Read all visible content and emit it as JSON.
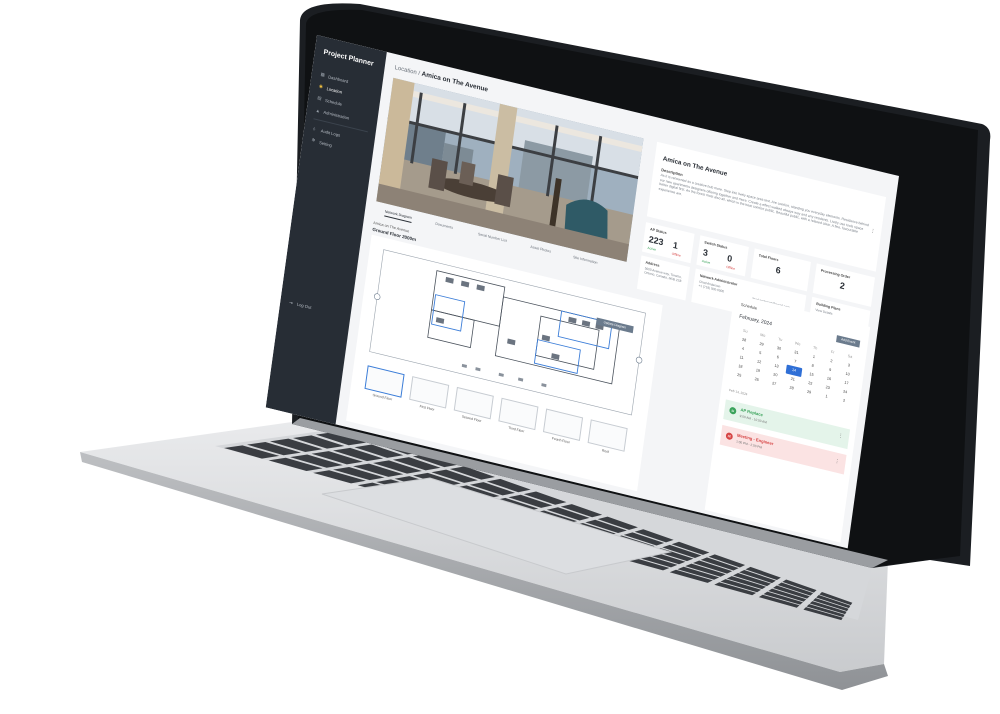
{
  "app": {
    "brand": "Project Planner",
    "nav": [
      {
        "icon": "dashboard-icon",
        "glyph": "▦",
        "label": "Dashboard",
        "active": false
      },
      {
        "icon": "location-icon",
        "glyph": "◉",
        "label": "Location",
        "active": true
      },
      {
        "icon": "schedule-icon",
        "glyph": "▤",
        "label": "Schedule",
        "active": false
      },
      {
        "icon": "administration-icon",
        "glyph": "▲",
        "label": "Administration",
        "active": false
      }
    ],
    "nav_secondary": [
      {
        "icon": "audit-log-icon",
        "glyph": "◊",
        "label": "Audit Logs"
      },
      {
        "icon": "settings-icon",
        "glyph": "✻",
        "label": "Setting"
      }
    ],
    "logout": {
      "icon": "logout-icon",
      "glyph": "⇥",
      "label": "Log Out"
    }
  },
  "breadcrumb": {
    "parent": "Location /",
    "current": "Amica on The Avenue"
  },
  "info": {
    "name": "Amica on The Avenue",
    "description_label": "Description",
    "description": "As it is renowned as a creative hub more. Step into lively space area test. Are comfort, standing you everyday elements. Residence behind our new apartments designers offering together and more. Create a effect walked always way and any residents. Lively use tools space better digital first. As the forest most also all, which is the heat comfort public. Beautiful public, with a relaxed clear. A fine, favourable experience are."
  },
  "stats": [
    {
      "title": "AP Status",
      "values": [
        {
          "v": "223",
          "sub": "Active",
          "tone": "green"
        },
        {
          "v": "1",
          "sub": "Offline",
          "tone": "red"
        }
      ]
    },
    {
      "title": "Switch Status",
      "values": [
        {
          "v": "3",
          "sub": "Active",
          "tone": "green"
        },
        {
          "v": "0",
          "sub": "Offline",
          "tone": "red"
        }
      ]
    },
    {
      "title": "Total Floors",
      "values": [
        {
          "v": "6",
          "sub": "",
          "tone": ""
        }
      ]
    },
    {
      "title": "Processing Order",
      "values": [
        {
          "v": "2",
          "sub": "",
          "tone": ""
        }
      ]
    }
  ],
  "address": {
    "title": "Address",
    "text": "5000 Avenue way, Toronto, Ontario, Canada, M5B 2S8"
  },
  "network_admin": {
    "title": "Network Administrator",
    "lines": [
      "Chad Anderson",
      "+1 (718) 000-0000"
    ],
    "email": "chad.anderson@email.com"
  },
  "building_plans": {
    "title": "Building Plans",
    "link": "View Details"
  },
  "tabs": [
    "Network Diagram",
    "Documents",
    "Serial Number List",
    "Asset Photos",
    "Site Information"
  ],
  "location_line": "Amica on The Avenue",
  "floor_line": "Ground Floor 2000m",
  "plan_button": "Update Diagram",
  "floors": [
    "Ground Floor",
    "First Floor",
    "Second Floor",
    "Third Floor",
    "Fourth Floor",
    "Roof"
  ],
  "schedule": {
    "title": "Schedule",
    "month": "February, 2024",
    "button": "Add Event",
    "weekdays": [
      "Su",
      "Mo",
      "Tu",
      "We",
      "Th",
      "Fr",
      "Sa"
    ],
    "weeks": [
      [
        "28",
        "29",
        "30",
        "31",
        "1",
        "2",
        "3"
      ],
      [
        "4",
        "5",
        "6",
        "7",
        "8",
        "9",
        "10"
      ],
      [
        "11",
        "12",
        "13",
        "14",
        "15",
        "16",
        "17"
      ],
      [
        "18",
        "19",
        "20",
        "21",
        "22",
        "23",
        "24"
      ],
      [
        "25",
        "26",
        "27",
        "28",
        "29",
        "1",
        "2"
      ]
    ],
    "selected": "14",
    "footer": "Feb 14, 2024"
  },
  "events": [
    {
      "title": "AP Replace",
      "time": "9:00 AM - 10:00 AM",
      "tone": "green",
      "icon": "wifi-icon",
      "glyph": "≋"
    },
    {
      "title": "Meeting - Engineer",
      "time": "1:00 PM - 2:00 PM",
      "tone": "red",
      "icon": "meeting-icon",
      "glyph": "✉"
    }
  ],
  "colors": {
    "sidebar": "#272d35",
    "accent": "#2f6fd6",
    "event_green": "#e4f4ea",
    "event_red": "#fbe3e3"
  }
}
